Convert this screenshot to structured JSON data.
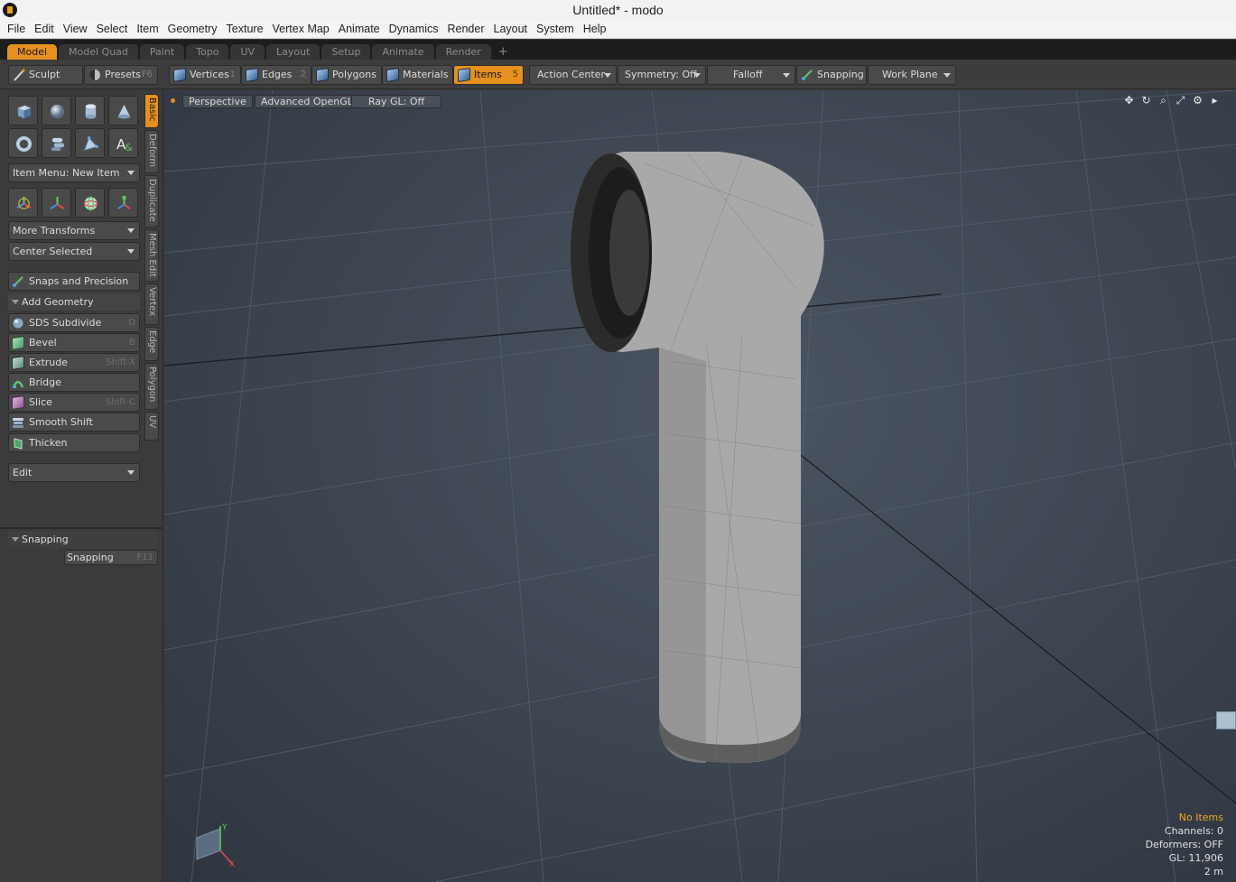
{
  "window": {
    "title": "Untitled* - modo"
  },
  "menu": [
    "File",
    "Edit",
    "View",
    "Select",
    "Item",
    "Geometry",
    "Texture",
    "Vertex Map",
    "Animate",
    "Dynamics",
    "Render",
    "Layout",
    "System",
    "Help"
  ],
  "layout_tabs": [
    "Model",
    "Model Quad",
    "Paint",
    "Topo",
    "UV",
    "Layout",
    "Setup",
    "Animate",
    "Render"
  ],
  "layout_tabs_active": "Model",
  "layout_add": "+",
  "toolbar": {
    "sculpt": "Sculpt",
    "presets": "Presets",
    "presets_key": "F6",
    "vertices": "Vertices",
    "vertices_key": "1",
    "edges": "Edges",
    "edges_key": "2",
    "polygons": "Polygons",
    "materials": "Materials",
    "items": "Items",
    "items_key": "5",
    "action_center": "Action Center",
    "symmetry": "Symmetry: Off",
    "falloff": "Falloff",
    "snapping": "Snapping",
    "work_plane": "Work Plane"
  },
  "left": {
    "item_menu": "Item Menu: New Item",
    "more_transforms": "More Transforms",
    "center_selected": "Center Selected",
    "snaps_precision": "Snaps and Precision",
    "add_geometry": "Add Geometry",
    "tools": [
      {
        "label": "SDS Subdivide",
        "key": "D"
      },
      {
        "label": "Bevel",
        "key": "B"
      },
      {
        "label": "Extrude",
        "key": "Shift-X"
      },
      {
        "label": "Bridge",
        "key": ""
      },
      {
        "label": "Slice",
        "key": "Shift-C"
      },
      {
        "label": "Smooth Shift",
        "key": ""
      },
      {
        "label": "Thicken",
        "key": ""
      }
    ],
    "edit": "Edit",
    "snapping_section": "Snapping",
    "snapping_btn": "Snapping",
    "snapping_key": "F11"
  },
  "vertical_tabs": [
    "Basic",
    "Deform",
    "Duplicate",
    "Mesh Edit",
    "Vertex",
    "Edge",
    "Polygon",
    "UV"
  ],
  "vertical_tabs_active": "Basic",
  "viewport": {
    "perspective": "Perspective",
    "opengl": "Advanced OpenGL",
    "raygl": "Ray GL: Off",
    "axis_x": "X",
    "axis_y": "Y",
    "stats": {
      "items": "No Items",
      "channels": "Channels: 0",
      "deformers": "Deformers: OFF",
      "gl": "GL: 11,906",
      "scale": "2 m"
    }
  },
  "colors": {
    "accent": "#e5901f",
    "viewport_bg": "#3c4450",
    "panel": "#3b3b3b"
  }
}
